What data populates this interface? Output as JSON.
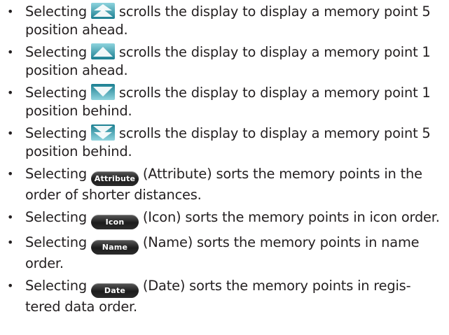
{
  "items": [
    {
      "before": "Selecting ",
      "icon": "double-up-arrow-icon",
      "after": " scrolls the display to display a memory point 5 position ahead."
    },
    {
      "before": "Selecting ",
      "icon": "up-arrow-icon",
      "after": " scrolls the display to display a memory point 1 position ahead."
    },
    {
      "before": "Selecting ",
      "icon": "down-arrow-icon",
      "after": " scrolls the display to display a memory point 1 position behind."
    },
    {
      "before": "Selecting ",
      "icon": "double-down-arrow-icon",
      "after": " scrolls the display to display a memory point 5 position behind."
    },
    {
      "before": "Selecting ",
      "button": "Attribute",
      "after": " (Attribute) sorts the memory points in the order of shorter distances."
    },
    {
      "before": "Selecting ",
      "button": "Icon",
      "after": " (Icon) sorts the memory points in icon order."
    },
    {
      "before": "Selecting ",
      "button": "Name",
      "after": " (Name) sorts the memory points in name order."
    },
    {
      "before": "Selecting ",
      "button": "Date",
      "after": " (Date) sorts the memory points in regis-tered data order."
    }
  ],
  "bullet_glyph": "•",
  "colors": {
    "text": "#231f20",
    "icon_teal": "#2aa3b4",
    "icon_dark": "#0f6c7e",
    "pill_dark": "#1c1c1c"
  }
}
